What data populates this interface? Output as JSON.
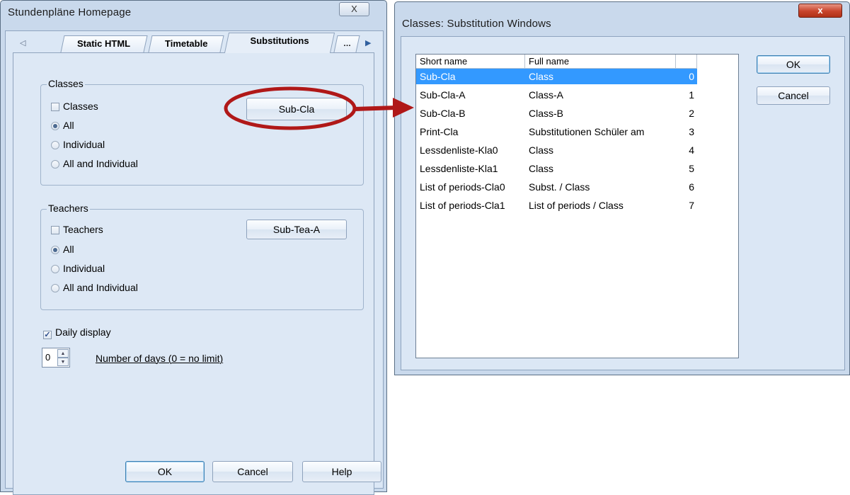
{
  "left_dialog": {
    "title": "Stundenpläne Homepage",
    "close_label": "X",
    "tabs": [
      "Static HTML",
      "Timetable",
      "Substitutions",
      "…"
    ],
    "classes_group": {
      "legend": "Classes",
      "checkbox_label": "Classes",
      "checkbox_checked": false,
      "button_label": "Sub-Cla",
      "radios": [
        {
          "label": "All",
          "selected": true
        },
        {
          "label": "Individual",
          "selected": false
        },
        {
          "label": "All and Individual",
          "selected": false
        }
      ]
    },
    "teachers_group": {
      "legend": "Teachers",
      "checkbox_label": "Teachers",
      "checkbox_checked": false,
      "button_label": "Sub-Tea-A",
      "radios": [
        {
          "label": "All",
          "selected": true
        },
        {
          "label": "Individual",
          "selected": false
        },
        {
          "label": "All and Individual",
          "selected": false
        }
      ]
    },
    "daily_display": {
      "label": "Daily display",
      "checked": true
    },
    "number_of_days": {
      "value": "0",
      "label": "Number of days (0 = no limit)"
    },
    "buttons": {
      "ok": "OK",
      "cancel": "Cancel",
      "help": "Help"
    }
  },
  "right_dialog": {
    "title": "Classes: Substitution Windows",
    "close_label": "x",
    "columns": [
      "Short name",
      "Full name",
      ""
    ],
    "rows": [
      {
        "short": "Sub-Cla",
        "full": "Class",
        "num": "0",
        "selected": true
      },
      {
        "short": "Sub-Cla-A",
        "full": "Class-A",
        "num": "1",
        "selected": false
      },
      {
        "short": "Sub-Cla-B",
        "full": "Class-B",
        "num": "2",
        "selected": false
      },
      {
        "short": "Print-Cla",
        "full": "Substitutionen Schüler am",
        "num": "3",
        "selected": false
      },
      {
        "short": "Lessdenliste-Kla0",
        "full": "Class",
        "num": "4",
        "selected": false
      },
      {
        "short": "Lessdenliste-Kla1",
        "full": "Class",
        "num": "5",
        "selected": false
      },
      {
        "short": "List of periods-Cla0",
        "full": "Subst. / Class",
        "num": "6",
        "selected": false
      },
      {
        "short": "List of periods-Cla1",
        "full": "List of periods / Class",
        "num": "7",
        "selected": false
      }
    ],
    "buttons": {
      "ok": "OK",
      "cancel": "Cancel"
    }
  },
  "colors": {
    "annotation": "#b01818",
    "selection": "#3399ff"
  }
}
